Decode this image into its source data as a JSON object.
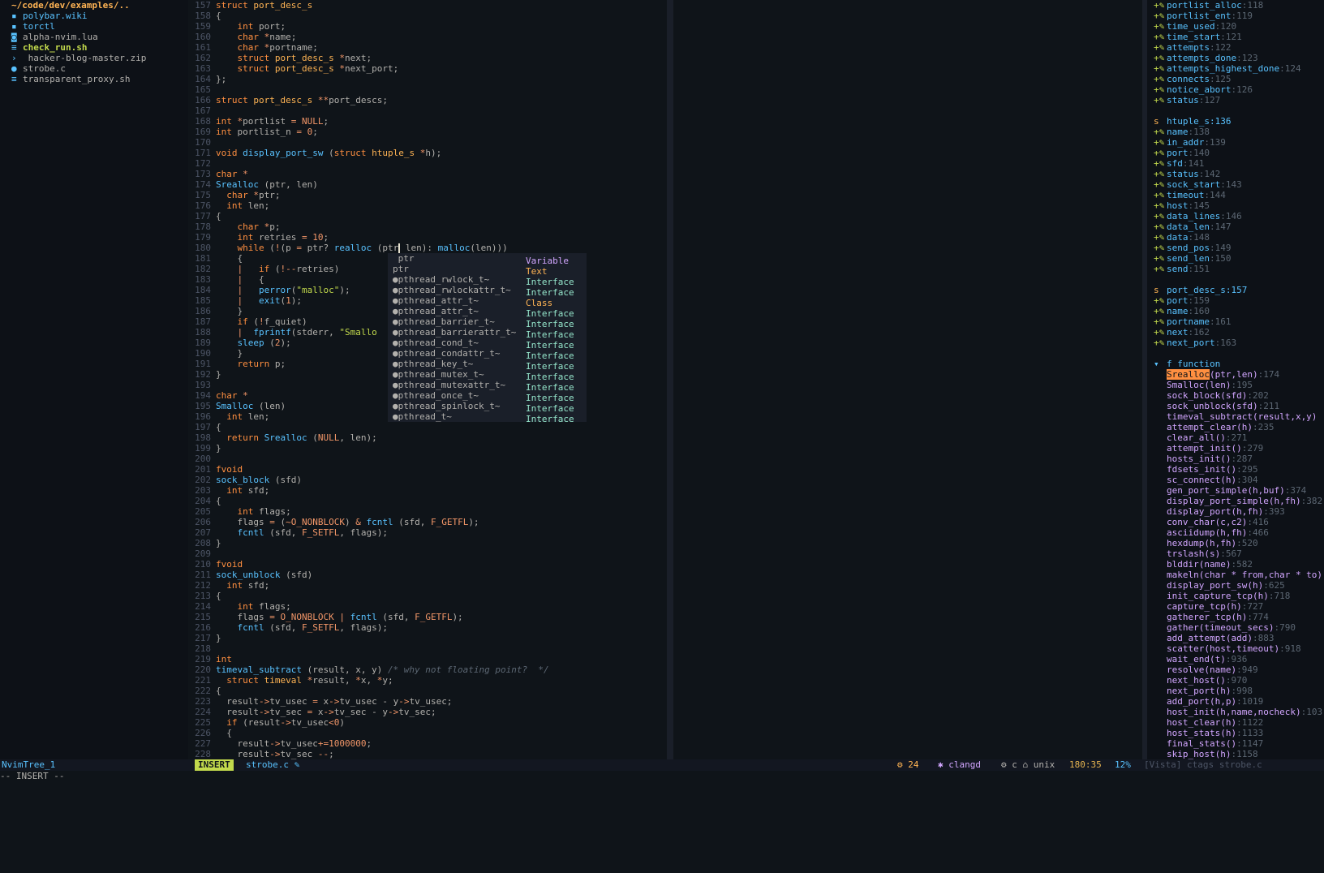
{
  "tree": {
    "root": "~/code/dev/examples/..",
    "items": [
      {
        "icon": "folder-icon",
        "glyph": "▪",
        "label": "polybar.wiki",
        "kind": "dir"
      },
      {
        "icon": "folder-icon",
        "glyph": "▪",
        "label": "torctl",
        "kind": "dir"
      },
      {
        "icon": "lua-file-icon",
        "glyph": "◙",
        "label": "alpha-nvim.lua",
        "kind": "file"
      },
      {
        "icon": "shell-file-icon",
        "glyph": "≡",
        "label": "check_run.sh",
        "kind": "exec"
      },
      {
        "icon": "archive-file-icon",
        "glyph": "›",
        "label": " hacker-blog-master.zip",
        "kind": "file"
      },
      {
        "icon": "c-file-icon",
        "glyph": "●",
        "label": "strobe.c",
        "kind": "file"
      },
      {
        "icon": "shell-file-icon",
        "glyph": "≡",
        "label": "transparent_proxy.sh",
        "kind": "file"
      }
    ]
  },
  "editor": {
    "lines": [
      {
        "n": "157",
        "t": "struct port_desc_s"
      },
      {
        "n": "158",
        "t": "{"
      },
      {
        "n": "159",
        "t": "    int port;"
      },
      {
        "n": "160",
        "t": "    char *name;"
      },
      {
        "n": "161",
        "t": "    char *portname;"
      },
      {
        "n": "162",
        "t": "    struct port_desc_s *next;"
      },
      {
        "n": "163",
        "t": "    struct port_desc_s *next_port;"
      },
      {
        "n": "164",
        "t": "};"
      },
      {
        "n": "165",
        "t": ""
      },
      {
        "n": "166",
        "t": "struct port_desc_s **port_descs;"
      },
      {
        "n": "167",
        "t": ""
      },
      {
        "n": "168",
        "t": "int *portlist = NULL;"
      },
      {
        "n": "169",
        "t": "int portlist_n = 0;"
      },
      {
        "n": "170",
        "t": ""
      },
      {
        "n": "171",
        "t": "void display_port_sw (struct htuple_s *h);"
      },
      {
        "n": "172",
        "t": ""
      },
      {
        "n": "173",
        "t": "char *"
      },
      {
        "n": "174",
        "t": "Srealloc (ptr, len)"
      },
      {
        "n": "175",
        "t": "  char *ptr;"
      },
      {
        "n": "176",
        "t": "  int len;"
      },
      {
        "n": "177",
        "t": "{"
      },
      {
        "n": "178",
        "t": "    char *p;"
      },
      {
        "n": "179",
        "t": "    int retries = 10;"
      },
      {
        "n": "180",
        "t": "    while (!(p = ptr? realloc (ptr  len): malloc(len)))"
      },
      {
        "n": "181",
        "t": "    {"
      },
      {
        "n": "182",
        "t": "    |   if (!--retries)"
      },
      {
        "n": "183",
        "t": "    |   {"
      },
      {
        "n": "184",
        "t": "    |   perror(\"malloc\");"
      },
      {
        "n": "185",
        "t": "    |   exit(1);"
      },
      {
        "n": "186",
        "t": "    }"
      },
      {
        "n": "187",
        "t": "    if (!f_quiet)"
      },
      {
        "n": "188",
        "t": "    |  fprintf(stderr, \"Smallo                       eping\\n\", len);"
      },
      {
        "n": "189",
        "t": "    sleep (2);"
      },
      {
        "n": "190",
        "t": "    }"
      },
      {
        "n": "191",
        "t": "    return p;"
      },
      {
        "n": "192",
        "t": "}"
      },
      {
        "n": "193",
        "t": ""
      },
      {
        "n": "194",
        "t": "char *"
      },
      {
        "n": "195",
        "t": "Smalloc (len)"
      },
      {
        "n": "196",
        "t": "  int len;"
      },
      {
        "n": "197",
        "t": "{"
      },
      {
        "n": "198",
        "t": "  return Srealloc (NULL, len);"
      },
      {
        "n": "199",
        "t": "}"
      },
      {
        "n": "200",
        "t": ""
      },
      {
        "n": "201",
        "t": "fvoid"
      },
      {
        "n": "202",
        "t": "sock_block (sfd)"
      },
      {
        "n": "203",
        "t": "  int sfd;"
      },
      {
        "n": "204",
        "t": "{"
      },
      {
        "n": "205",
        "t": "    int flags;"
      },
      {
        "n": "206",
        "t": "    flags = (~O_NONBLOCK) & fcntl (sfd, F_GETFL);"
      },
      {
        "n": "207",
        "t": "    fcntl (sfd, F_SETFL, flags);"
      },
      {
        "n": "208",
        "t": "}"
      },
      {
        "n": "209",
        "t": ""
      },
      {
        "n": "210",
        "t": "fvoid"
      },
      {
        "n": "211",
        "t": "sock_unblock (sfd)"
      },
      {
        "n": "212",
        "t": "  int sfd;"
      },
      {
        "n": "213",
        "t": "{"
      },
      {
        "n": "214",
        "t": "    int flags;"
      },
      {
        "n": "215",
        "t": "    flags = O_NONBLOCK | fcntl (sfd, F_GETFL);"
      },
      {
        "n": "216",
        "t": "    fcntl (sfd, F_SETFL, flags);"
      },
      {
        "n": "217",
        "t": "}"
      },
      {
        "n": "218",
        "t": ""
      },
      {
        "n": "219",
        "t": "int"
      },
      {
        "n": "220",
        "t": "timeval_subtract (result, x, y) /* why not floating point?  */"
      },
      {
        "n": "221",
        "t": "  struct timeval *result, *x, *y;"
      },
      {
        "n": "222",
        "t": "{"
      },
      {
        "n": "223",
        "t": "  result->tv_usec = x->tv_usec - y->tv_usec;"
      },
      {
        "n": "224",
        "t": "  result->tv_sec = x->tv_sec - y->tv_sec;"
      },
      {
        "n": "225",
        "t": "  if (result->tv_usec<0)"
      },
      {
        "n": "226",
        "t": "  {"
      },
      {
        "n": "227",
        "t": "    result->tv_usec+=1000000;"
      },
      {
        "n": "228",
        "t": "    result->tv_sec --;"
      }
    ]
  },
  "popup": {
    "items": [
      {
        "label": " ptr",
        "kind": "Variable",
        "cls": "var"
      },
      {
        "label": "ptr",
        "kind": "Text",
        "cls": "text"
      },
      {
        "label": "●pthread_rwlock_t~",
        "kind": "Interface",
        "cls": ""
      },
      {
        "label": "●pthread_rwlockattr_t~",
        "kind": "Interface",
        "cls": ""
      },
      {
        "label": "●pthread_attr_t~",
        "kind": "Class",
        "cls": "class"
      },
      {
        "label": "●pthread_attr_t~",
        "kind": "Interface",
        "cls": ""
      },
      {
        "label": "●pthread_barrier_t~",
        "kind": "Interface",
        "cls": ""
      },
      {
        "label": "●pthread_barrierattr_t~",
        "kind": "Interface",
        "cls": ""
      },
      {
        "label": "●pthread_cond_t~",
        "kind": "Interface",
        "cls": ""
      },
      {
        "label": "●pthread_condattr_t~",
        "kind": "Interface",
        "cls": ""
      },
      {
        "label": "●pthread_key_t~",
        "kind": "Interface",
        "cls": ""
      },
      {
        "label": "●pthread_mutex_t~",
        "kind": "Interface",
        "cls": ""
      },
      {
        "label": "●pthread_mutexattr_t~",
        "kind": "Interface",
        "cls": ""
      },
      {
        "label": "●pthread_once_t~",
        "kind": "Interface",
        "cls": ""
      },
      {
        "label": "●pthread_spinlock_t~",
        "kind": "Interface",
        "cls": ""
      },
      {
        "label": "●pthread_t~",
        "kind": "Interface",
        "cls": ""
      }
    ]
  },
  "vista": {
    "lines": [
      {
        "type": "field",
        "name": "portlist_alloc",
        "num": "118"
      },
      {
        "type": "field",
        "name": "portlist_ent",
        "num": "119"
      },
      {
        "type": "field",
        "name": "time_used",
        "num": "120"
      },
      {
        "type": "field",
        "name": "time_start",
        "num": "121"
      },
      {
        "type": "field",
        "name": "attempts",
        "num": "122"
      },
      {
        "type": "field",
        "name": "attempts_done",
        "num": "123"
      },
      {
        "type": "field",
        "name": "attempts_highest_done",
        "num": "124"
      },
      {
        "type": "field",
        "name": "connects",
        "num": "125"
      },
      {
        "type": "field",
        "name": "notice_abort",
        "num": "126"
      },
      {
        "type": "field",
        "name": "status",
        "num": "127"
      },
      {
        "type": "blank",
        "name": "",
        "num": ""
      },
      {
        "type": "struct",
        "name": "htuple_s",
        "num": "136"
      },
      {
        "type": "field",
        "name": "name",
        "num": "138"
      },
      {
        "type": "field",
        "name": "in_addr",
        "num": "139"
      },
      {
        "type": "field",
        "name": "port",
        "num": "140"
      },
      {
        "type": "field",
        "name": "sfd",
        "num": "141"
      },
      {
        "type": "field",
        "name": "status",
        "num": "142"
      },
      {
        "type": "field",
        "name": "sock_start",
        "num": "143"
      },
      {
        "type": "field",
        "name": "timeout",
        "num": "144"
      },
      {
        "type": "field",
        "name": "host",
        "num": "145"
      },
      {
        "type": "field",
        "name": "data_lines",
        "num": "146"
      },
      {
        "type": "field",
        "name": "data_len",
        "num": "147"
      },
      {
        "type": "field",
        "name": "data",
        "num": "148"
      },
      {
        "type": "field",
        "name": "send_pos",
        "num": "149"
      },
      {
        "type": "field",
        "name": "send_len",
        "num": "150"
      },
      {
        "type": "field",
        "name": "send",
        "num": "151"
      },
      {
        "type": "blank",
        "name": "",
        "num": ""
      },
      {
        "type": "struct",
        "name": "port_desc_s",
        "num": "157"
      },
      {
        "type": "field",
        "name": "port",
        "num": "159"
      },
      {
        "type": "field",
        "name": "name",
        "num": "160"
      },
      {
        "type": "field",
        "name": "portname",
        "num": "161"
      },
      {
        "type": "field",
        "name": "next",
        "num": "162"
      },
      {
        "type": "field",
        "name": "next_port",
        "num": "163"
      },
      {
        "type": "blank",
        "name": "",
        "num": ""
      },
      {
        "type": "group",
        "name": "f function",
        "num": ""
      },
      {
        "type": "fnhl",
        "name": "Srealloc",
        "rest": "(ptr,len)",
        "num": "174"
      },
      {
        "type": "fn",
        "name": "Smalloc(len)",
        "num": "195"
      },
      {
        "type": "fn",
        "name": "sock_block(sfd)",
        "num": "202"
      },
      {
        "type": "fn",
        "name": "sock_unblock(sfd)",
        "num": "211"
      },
      {
        "type": "fn",
        "name": "timeval_subtract(result,x,y)",
        "num": ""
      },
      {
        "type": "fn",
        "name": "attempt_clear(h)",
        "num": "235"
      },
      {
        "type": "fn",
        "name": "clear_all()",
        "num": "271"
      },
      {
        "type": "fn",
        "name": "attempt_init()",
        "num": "279"
      },
      {
        "type": "fn",
        "name": "hosts_init()",
        "num": "287"
      },
      {
        "type": "fn",
        "name": "fdsets_init()",
        "num": "295"
      },
      {
        "type": "fn",
        "name": "sc_connect(h)",
        "num": "304"
      },
      {
        "type": "fn",
        "name": "gen_port_simple(h,buf)",
        "num": "374"
      },
      {
        "type": "fn",
        "name": "display_port_simple(h,fh)",
        "num": "382"
      },
      {
        "type": "fn",
        "name": "display_port(h,fh)",
        "num": "393"
      },
      {
        "type": "fn",
        "name": "conv_char(c,c2)",
        "num": "416"
      },
      {
        "type": "fn",
        "name": "asciidump(h,fh)",
        "num": "466"
      },
      {
        "type": "fn",
        "name": "hexdump(h,fh)",
        "num": "520"
      },
      {
        "type": "fn",
        "name": "trslash(s)",
        "num": "567"
      },
      {
        "type": "fn",
        "name": "blddir(name)",
        "num": "582"
      },
      {
        "type": "fn",
        "name": "makeln(char * from,char * to)",
        "num": ""
      },
      {
        "type": "fn",
        "name": "display_port_sw(h)",
        "num": "625"
      },
      {
        "type": "fn",
        "name": "init_capture_tcp(h)",
        "num": "718"
      },
      {
        "type": "fn",
        "name": "capture_tcp(h)",
        "num": "727"
      },
      {
        "type": "fn",
        "name": "gatherer_tcp(h)",
        "num": "774"
      },
      {
        "type": "fn",
        "name": "gather(timeout_secs)",
        "num": "790"
      },
      {
        "type": "fn",
        "name": "add_attempt(add)",
        "num": "883"
      },
      {
        "type": "fn",
        "name": "scatter(host,timeout)",
        "num": "918"
      },
      {
        "type": "fn",
        "name": "wait_end(t)",
        "num": "936"
      },
      {
        "type": "fn",
        "name": "resolve(name)",
        "num": "949"
      },
      {
        "type": "fn",
        "name": "next_host()",
        "num": "970"
      },
      {
        "type": "fn",
        "name": "next_port(h)",
        "num": "998"
      },
      {
        "type": "fn",
        "name": "add_port(h,p)",
        "num": "1019"
      },
      {
        "type": "fn",
        "name": "host_init(h,name,nocheck)",
        "num": "103"
      },
      {
        "type": "fn",
        "name": "host_clear(h)",
        "num": "1122"
      },
      {
        "type": "fn",
        "name": "host_stats(h)",
        "num": "1133"
      },
      {
        "type": "fn",
        "name": "final_stats()",
        "num": "1147"
      },
      {
        "type": "fn",
        "name": "skip_host(h)",
        "num": "1158"
      }
    ]
  },
  "status": {
    "tree": "NvimTree_1",
    "mode": "INSERT",
    "file": "strobe.c ✎",
    "diag": "⚙ 24",
    "lsp": "✱ clangd",
    "ft": "⚙ c ⌂ unix",
    "pos": "180:35",
    "pct": "12%",
    "vista": "[Vista] ctags strobe.c"
  },
  "cmdline": "-- INSERT --"
}
